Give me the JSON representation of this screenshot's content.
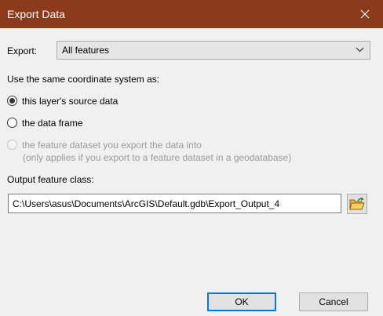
{
  "window": {
    "title": "Export Data",
    "close_icon": "close-icon"
  },
  "export": {
    "label": "Export:",
    "selected": "All features",
    "icon": "chevron-down-icon"
  },
  "coordinate_system": {
    "heading": "Use the same coordinate system as:",
    "options": [
      {
        "label": "this layer's source data",
        "checked": true,
        "disabled": false
      },
      {
        "label": "the data frame",
        "checked": false,
        "disabled": false
      },
      {
        "label": "the feature dataset you export the data into",
        "checked": false,
        "disabled": true
      }
    ],
    "note": "(only applies if you export to a feature dataset in a geodatabase)"
  },
  "output": {
    "label": "Output feature class:",
    "value": "C:\\Users\\asus\\Documents\\ArcGIS\\Default.gdb\\Export_Output_4",
    "browse_icon": "open-folder-icon"
  },
  "buttons": {
    "ok": "OK",
    "cancel": "Cancel"
  },
  "colors": {
    "titlebar": "#8b3a1c",
    "dialog_background": "#f0f0f0",
    "default_button_border": "#0078d7",
    "folder_icon": "#e8b53a"
  }
}
